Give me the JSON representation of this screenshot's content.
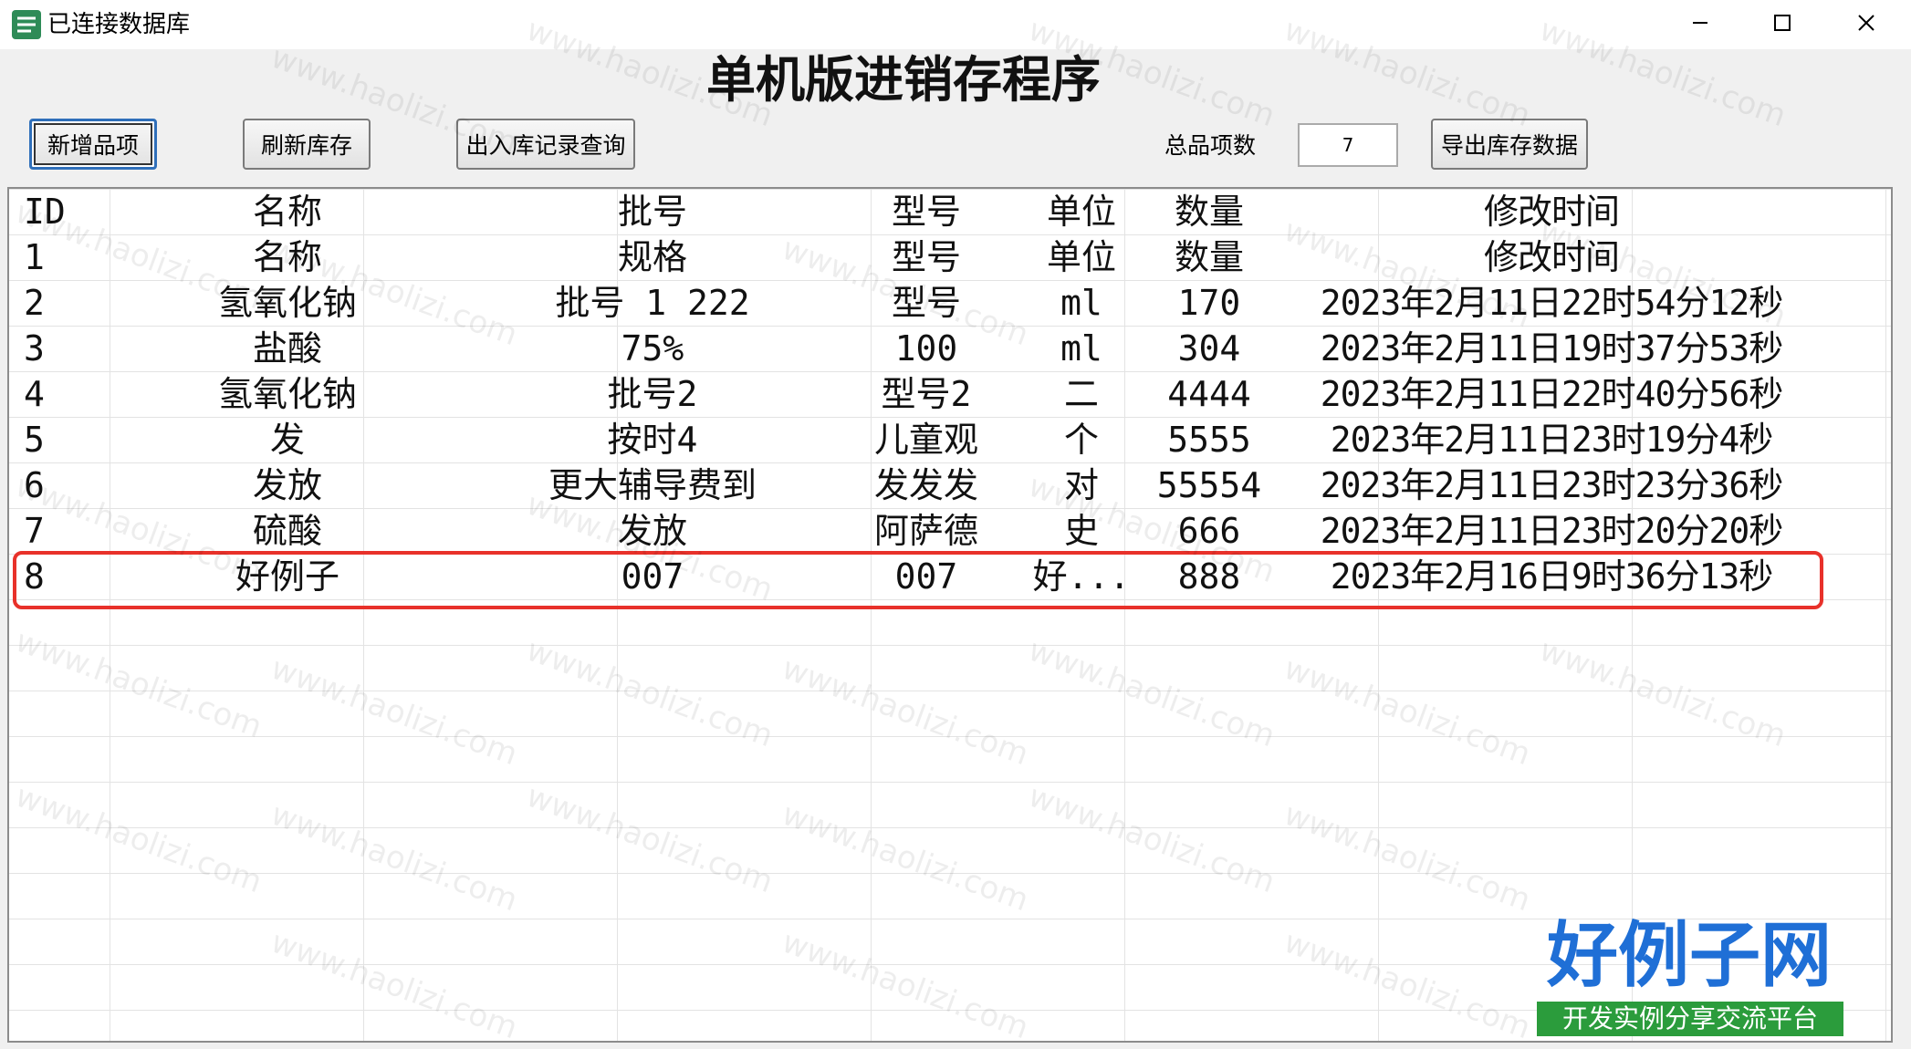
{
  "window": {
    "title": "已连接数据库",
    "minimize_icon": "minimize-icon",
    "maximize_icon": "maximize-icon",
    "close_icon": "close-icon"
  },
  "heading": "单机版进销存程序",
  "toolbar": {
    "add_item_label": "新增品项",
    "refresh_label": "刷新库存",
    "records_query_label": "出入库记录查询",
    "total_items_label": "总品项数",
    "total_items_value": "7",
    "export_label": "导出库存数据"
  },
  "table": {
    "columns": [
      "ID",
      "名称",
      "批号",
      "型号",
      "单位",
      "数量",
      "修改时间"
    ],
    "rows": [
      {
        "id": "1",
        "name": "名称",
        "batch": "规格",
        "model": "型号",
        "unit": "单位",
        "qty": "数量",
        "time": "修改时间"
      },
      {
        "id": "2",
        "name": "氢氧化钠",
        "batch": "批号 1 222",
        "model": "型号",
        "unit": "ml",
        "qty": "170",
        "time": "2023年2月11日22时54分12秒"
      },
      {
        "id": "3",
        "name": "盐酸",
        "batch": "75%",
        "model": "100",
        "unit": "ml",
        "qty": "304",
        "time": "2023年2月11日19时37分53秒"
      },
      {
        "id": "4",
        "name": "氢氧化钠",
        "batch": "批号2",
        "model": "型号2",
        "unit": "二",
        "qty": "4444",
        "time": "2023年2月11日22时40分56秒"
      },
      {
        "id": "5",
        "name": "发",
        "batch": "按时4",
        "model": "儿童观",
        "unit": "个",
        "qty": "5555",
        "time": "2023年2月11日23时19分4秒"
      },
      {
        "id": "6",
        "name": "发放",
        "batch": "更大辅导费到",
        "model": "发发发",
        "unit": "对",
        "qty": "55554",
        "time": "2023年2月11日23时23分36秒"
      },
      {
        "id": "7",
        "name": "硫酸",
        "batch": "发放",
        "model": "阿萨德",
        "unit": "史",
        "qty": "666",
        "time": "2023年2月11日23时20分20秒"
      },
      {
        "id": "8",
        "name": "好例子",
        "batch": "007",
        "model": "007",
        "unit": "好...",
        "qty": "888",
        "time": "2023年2月16日9时36分13秒"
      }
    ]
  },
  "watermark": "www.haolizi.com",
  "logo": {
    "main": "好例子网",
    "sub": "开发实例分享交流平台"
  },
  "colors": {
    "highlight": "#e8312a",
    "logo_blue": "#1f6fd6",
    "logo_green": "#2b9c3c"
  }
}
